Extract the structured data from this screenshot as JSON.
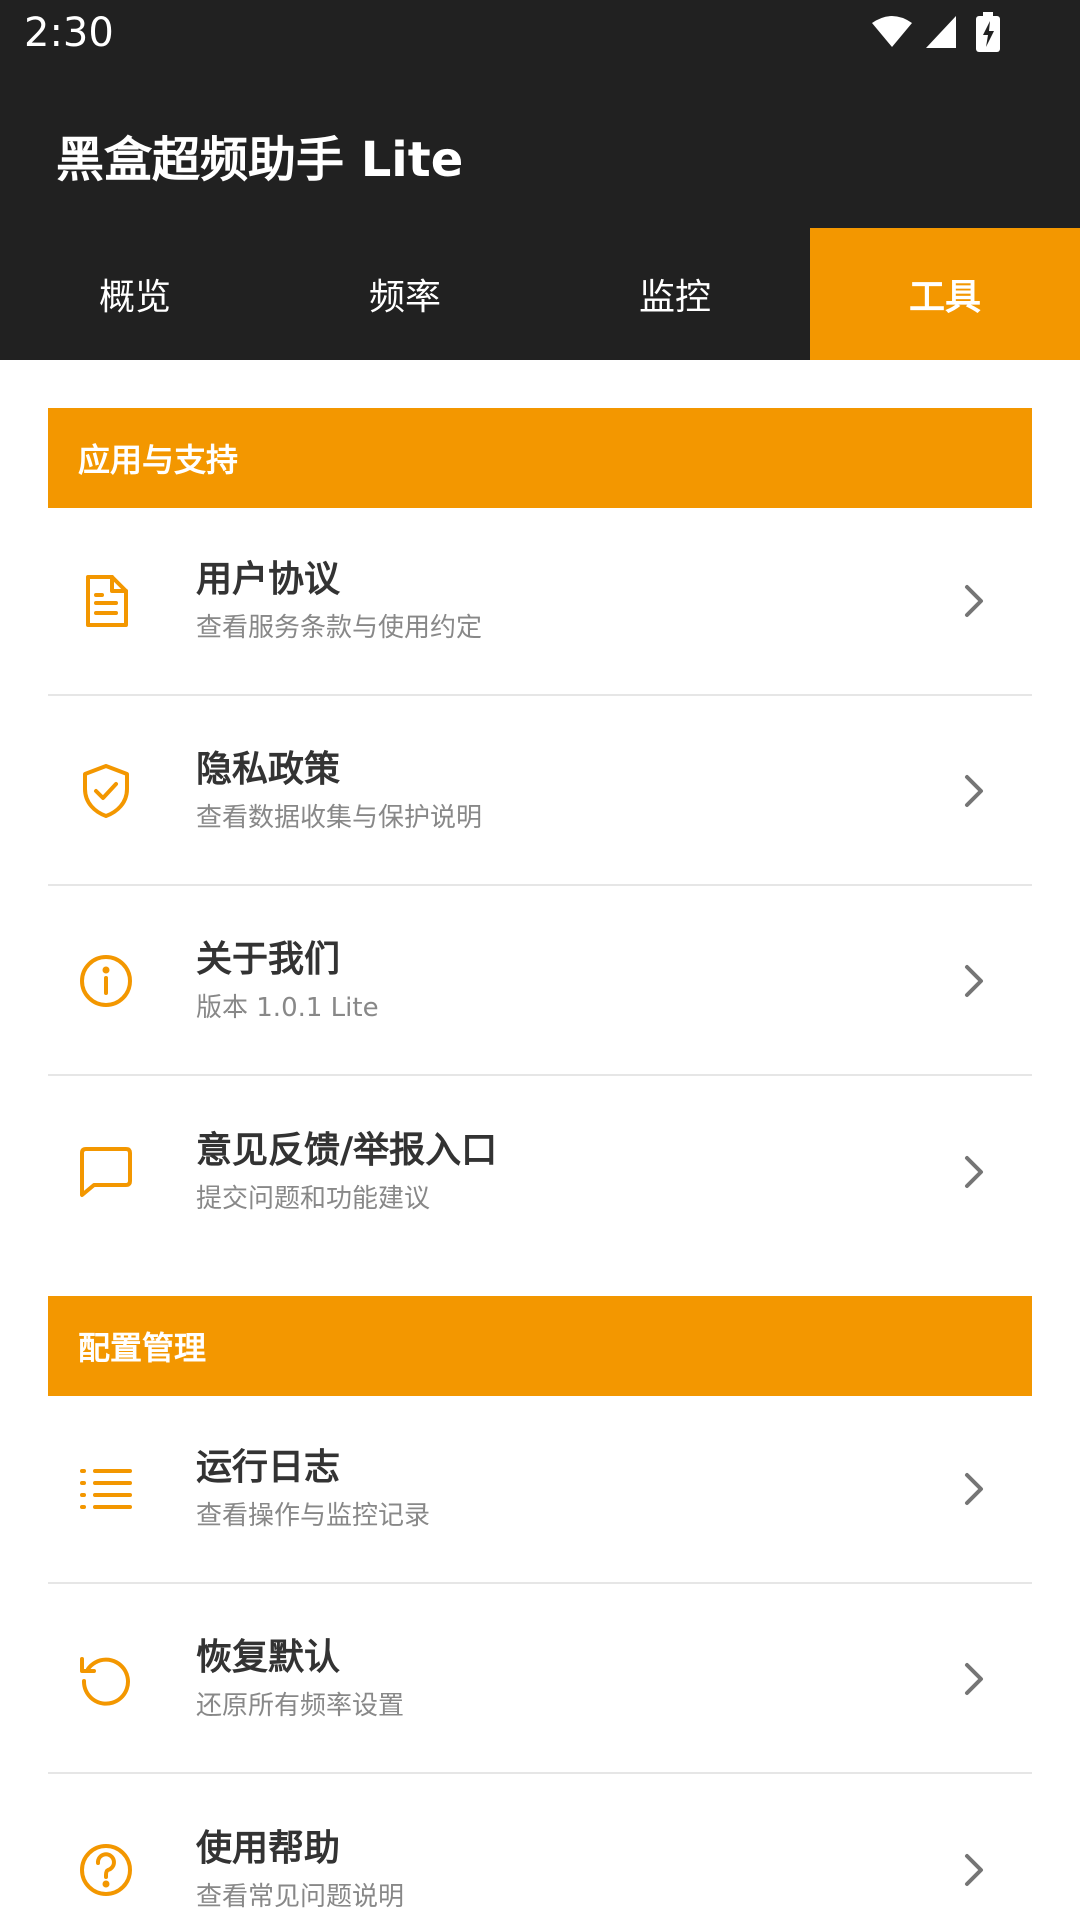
{
  "status": {
    "time": "2:30"
  },
  "app": {
    "title": "黑盒超频助手 Lite"
  },
  "tabs": [
    {
      "label": "概览",
      "active": false
    },
    {
      "label": "频率",
      "active": false
    },
    {
      "label": "监控",
      "active": false
    },
    {
      "label": "工具",
      "active": true
    }
  ],
  "accent_color": "#F39700",
  "sections": [
    {
      "header": "应用与支持",
      "items": [
        {
          "title": "用户协议",
          "subtitle": "查看服务条款与使用约定",
          "icon": "document-icon"
        },
        {
          "title": "隐私政策",
          "subtitle": "查看数据收集与保护说明",
          "icon": "shield-check-icon"
        },
        {
          "title": "关于我们",
          "subtitle": "版本 1.0.1 Lite",
          "icon": "info-icon"
        },
        {
          "title": "意见反馈/举报入口",
          "subtitle": "提交问题和功能建议",
          "icon": "message-icon"
        }
      ]
    },
    {
      "header": "配置管理",
      "items": [
        {
          "title": "运行日志",
          "subtitle": "查看操作与监控记录",
          "icon": "list-icon"
        },
        {
          "title": "恢复默认",
          "subtitle": "还原所有频率设置",
          "icon": "reset-icon"
        },
        {
          "title": "使用帮助",
          "subtitle": "查看常见问题说明",
          "icon": "help-icon"
        }
      ]
    }
  ]
}
